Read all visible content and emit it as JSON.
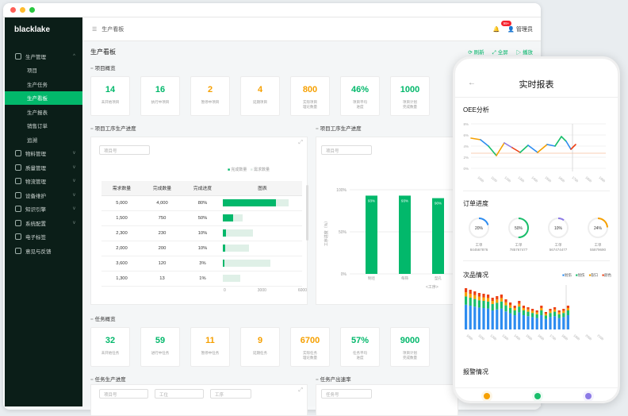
{
  "app": {
    "brand": "blacklake"
  },
  "sidebar": {
    "items": [
      {
        "label": "生产管理",
        "sub": false,
        "active": false,
        "chev": "^"
      },
      {
        "label": "项目",
        "sub": true
      },
      {
        "label": "生产任务",
        "sub": true
      },
      {
        "label": "生产看板",
        "sub": true,
        "active": true
      },
      {
        "label": "生产报表",
        "sub": true
      },
      {
        "label": "销售订单",
        "sub": true
      },
      {
        "label": "追溯",
        "sub": true
      },
      {
        "label": "物料管理",
        "chev": "v"
      },
      {
        "label": "质量管理",
        "chev": "v"
      },
      {
        "label": "物流管理",
        "chev": "v"
      },
      {
        "label": "设备维护",
        "chev": "v"
      },
      {
        "label": "知识引擎",
        "chev": "v"
      },
      {
        "label": "系统配置",
        "chev": "v"
      },
      {
        "label": "电子标签"
      },
      {
        "label": "意见与反馈"
      }
    ]
  },
  "header": {
    "breadcrumb": "生产看板",
    "notif_count": "99+",
    "user": "管理员"
  },
  "page": {
    "title": "生产看板",
    "refresh": "刷新",
    "fullscreen": "全屏",
    "play": "播放"
  },
  "project_overview": {
    "title": "项目概览",
    "kpis": [
      {
        "value": "14",
        "label": "未开始项目"
      },
      {
        "value": "16",
        "label": "执行中项目"
      },
      {
        "value": "2",
        "label": "暂停中项目",
        "orange": true
      },
      {
        "value": "4",
        "label": "延期项目",
        "orange": true
      },
      {
        "value": "800",
        "label": "实际项目\n理论数量",
        "orange": true
      },
      {
        "value": "46%",
        "label": "项目平均\n进度"
      },
      {
        "value": "1000",
        "label": "项目计划\n完成数量"
      }
    ]
  },
  "process_progress": {
    "title": "项目工序生产进度",
    "filter_placeholder": "项目号",
    "legend": [
      "完成数量",
      "需求数量"
    ],
    "columns": [
      "需求数量",
      "完成数量",
      "完成进度",
      "图表"
    ],
    "rows": [
      {
        "demand": "5,000",
        "done": "4,000",
        "pct": "80%",
        "d": 5000,
        "c": 4000
      },
      {
        "demand": "1,500",
        "done": "750",
        "pct": "50%",
        "d": 1500,
        "c": 750
      },
      {
        "demand": "2,300",
        "done": "230",
        "pct": "10%",
        "d": 2300,
        "c": 230
      },
      {
        "demand": "2,000",
        "done": "200",
        "pct": "10%",
        "d": 2000,
        "c": 200
      },
      {
        "demand": "3,600",
        "done": "120",
        "pct": "3%",
        "d": 3600,
        "c": 120
      },
      {
        "demand": "1,300",
        "done": "13",
        "pct": "1%",
        "d": 1300,
        "c": 13
      }
    ],
    "axis": [
      "0",
      "3000",
      "6000"
    ]
  },
  "process_chart": {
    "title": "项目工序生产进度",
    "filter_placeholder": "项目号",
    "ylabel": "工序进度（%）",
    "yticks": [
      "100%",
      "50%",
      "0%"
    ],
    "xlabel": "<工序>",
    "bars": [
      {
        "cat": "制坯",
        "value": 93,
        "label": "93%"
      },
      {
        "cat": "每筛",
        "value": 93,
        "label": "93%"
      },
      {
        "cat": "型孔",
        "value": 90,
        "label": "90%"
      }
    ]
  },
  "task_overview": {
    "title": "任务概览",
    "kpis": [
      {
        "value": "32",
        "label": "未开始任务"
      },
      {
        "value": "59",
        "label": "进行中任务"
      },
      {
        "value": "11",
        "label": "暂停中任务",
        "orange": true
      },
      {
        "value": "9",
        "label": "延期任务",
        "orange": true
      },
      {
        "value": "6700",
        "label": "实际任务\n理论数量",
        "orange": true
      },
      {
        "value": "57%",
        "label": "任务平均\n进度"
      },
      {
        "value": "9000",
        "label": "项目计划\n完成数量"
      }
    ]
  },
  "task_progress": {
    "title": "任务生产进度",
    "filters": [
      "项目号",
      "工位",
      "工序"
    ]
  },
  "task_yield": {
    "title": "任务产出速率",
    "filter": "任务号"
  },
  "phone": {
    "title": "实时报表",
    "oee": {
      "title": "OEE分析",
      "yticks": [
        "8%",
        "6%",
        "4%",
        "2%",
        "0%"
      ],
      "xticks": [
        "1000",
        "1100",
        "1200",
        "1300",
        "1400",
        "1500",
        "1600",
        "1700",
        "1800",
        "1900"
      ]
    },
    "orders": {
      "title": "订单进度",
      "items": [
        {
          "pct": "20%",
          "value": 20,
          "line1": "工单",
          "line2": "844567876",
          "color": "#2d8cf0"
        },
        {
          "pct": "50%",
          "value": 50,
          "line1": "工单",
          "line2": "785767477",
          "color": "#19be6b"
        },
        {
          "pct": "10%",
          "value": 10,
          "line1": "工单",
          "line2": "567474477",
          "color": "#8c7ae6"
        },
        {
          "pct": "24%",
          "value": 24,
          "line1": "工单",
          "line2": "55879690",
          "color": "#f6a000"
        }
      ]
    },
    "defects": {
      "title": "次品情况",
      "legend": [
        {
          "name": "划伤",
          "color": "#2d8cf0"
        },
        {
          "name": "划伤",
          "color": "#19be6b"
        },
        {
          "name": "裂口",
          "color": "#f6a000"
        },
        {
          "name": "颜色",
          "color": "#ed4014"
        }
      ],
      "xticks": [
        "1000",
        "1100",
        "1200",
        "1300",
        "1400",
        "1500",
        "1600",
        "1700",
        "1800",
        "1900",
        "2000",
        "2100"
      ]
    },
    "alarms": {
      "title": "报警情况"
    }
  },
  "colors": {
    "accent": "#02b86b",
    "warn": "#f6a000",
    "sidebar": "#0b1e18"
  }
}
